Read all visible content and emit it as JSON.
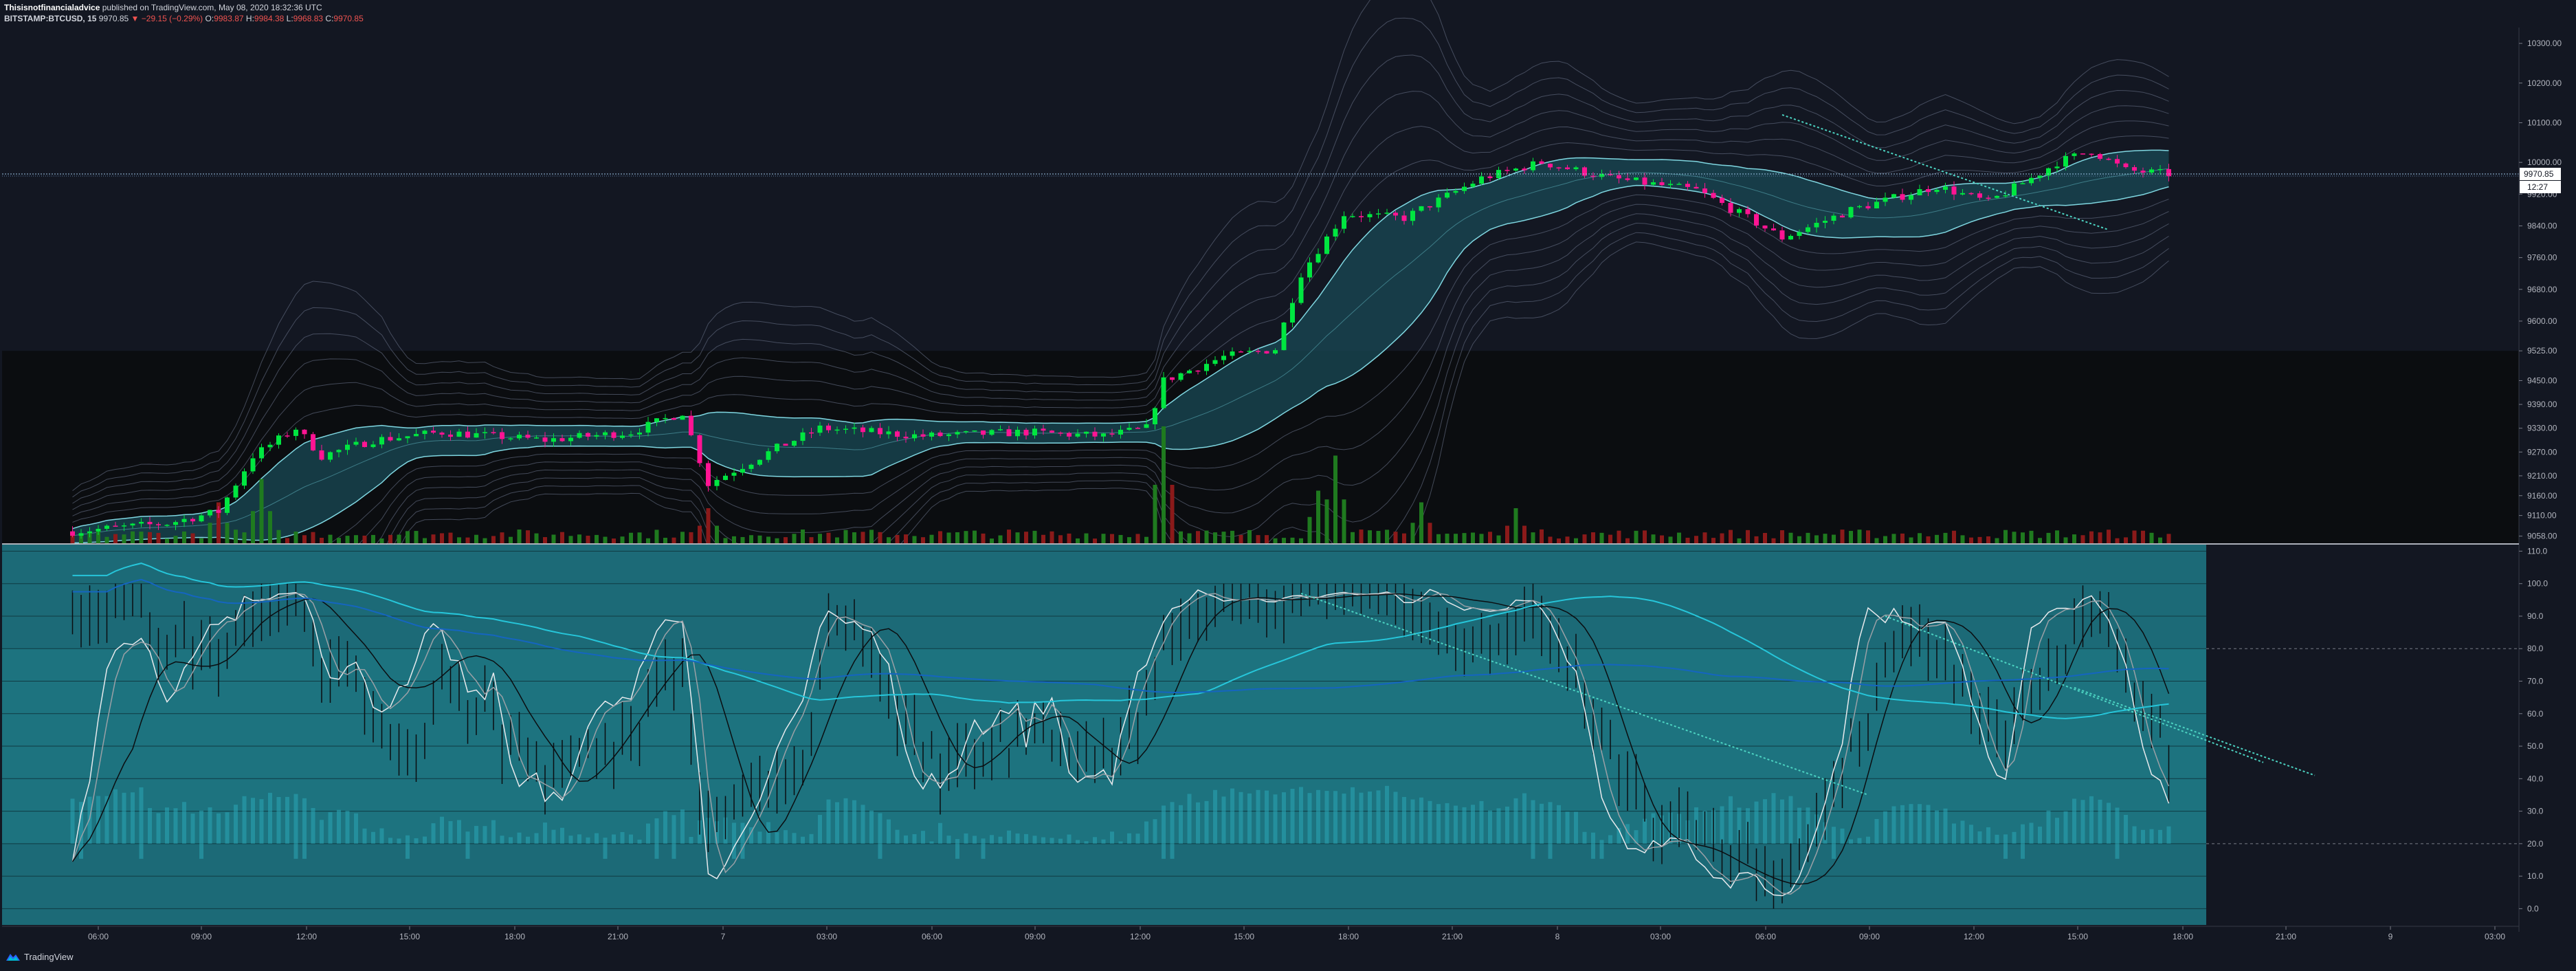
{
  "header": {
    "author": "Thisisnotfinancialadvice",
    "published": "published on TradingView.com, May 08, 2020 18:32:36 UTC",
    "symbol": "BITSTAMP:BTCUSD, 15",
    "last_price": "9970.85",
    "change_arrow": "▼",
    "change": "−29.15 (−0.29%)",
    "o_label": "O:",
    "o": "9983.87",
    "h_label": "H:",
    "h": "9984.38",
    "l_label": "L:",
    "l": "9968.83",
    "c_label": "C:",
    "c": "9970.85"
  },
  "footer": {
    "brand": "TradingView",
    "logo_icon": "tradingview-logo-icon"
  },
  "price_labels": {
    "last": "9970.85",
    "countdown": "12:27"
  },
  "colors": {
    "background": "#131722",
    "up_candle": "#00e640",
    "down_candle": "#ff1493",
    "volume_up": "#1f7a1f",
    "volume_down": "#8b1a1a",
    "band_fill": "#1a4a55",
    "band_line": "#7fd6e0",
    "oscillator_bg": "#1c6a77",
    "ma_cyan": "#26c6da",
    "ma_blue": "#1565c0",
    "trendline": "#4cd3c2"
  },
  "chart_data": [
    {
      "type": "candlestick",
      "title": "BITSTAMP:BTCUSD, 15",
      "ylim": [
        9040,
        10340
      ],
      "y_ticks": [
        "10300.00",
        "10200.00",
        "10100.00",
        "10000.00",
        "9920.00",
        "9840.00",
        "9760.00",
        "9680.00",
        "9600.00",
        "9525.00",
        "9450.00",
        "9390.00",
        "9330.00",
        "9270.00",
        "9210.00",
        "9160.00",
        "9110.00",
        "9058.00"
      ],
      "x_ticks": [
        "06:00",
        "09:00",
        "12:00",
        "15:00",
        "18:00",
        "21:00",
        "7",
        "03:00",
        "06:00",
        "09:00",
        "12:00",
        "15:00",
        "18:00",
        "21:00",
        "8",
        "03:00",
        "06:00",
        "09:00",
        "12:00",
        "15:00",
        "18:00",
        "21:00",
        "9",
        "03:00"
      ],
      "price_keypoints": [
        {
          "x": "05:15",
          "price": 9070
        },
        {
          "x": "08:00",
          "price": 9090
        },
        {
          "x": "09:30",
          "price": 9120
        },
        {
          "x": "10:30",
          "price": 9260
        },
        {
          "x": "11:45",
          "price": 9330
        },
        {
          "x": "12:30",
          "price": 9260
        },
        {
          "x": "14:00",
          "price": 9300
        },
        {
          "x": "16:00",
          "price": 9320
        },
        {
          "x": "19:00",
          "price": 9300
        },
        {
          "x": "21:30",
          "price": 9320
        },
        {
          "x": "23:00",
          "price": 9370
        },
        {
          "x": "23:45",
          "price": 9190
        },
        {
          "x": "7 01:45",
          "price": 9280
        },
        {
          "x": "7 03:00",
          "price": 9330
        },
        {
          "x": "7 06:00",
          "price": 9310
        },
        {
          "x": "7 09:00",
          "price": 9320
        },
        {
          "x": "7 11:15",
          "price": 9310
        },
        {
          "x": "7 12:30",
          "price": 9330
        },
        {
          "x": "7 13:00",
          "price": 9450
        },
        {
          "x": "7 14:45",
          "price": 9510
        },
        {
          "x": "7 16:15",
          "price": 9530
        },
        {
          "x": "7 17:00",
          "price": 9720
        },
        {
          "x": "7 18:15",
          "price": 9870
        },
        {
          "x": "7 20:00",
          "price": 9860
        },
        {
          "x": "7 22:15",
          "price": 9960
        },
        {
          "x": "8 00:00",
          "price": 10000
        },
        {
          "x": "8 02:00",
          "price": 9960
        },
        {
          "x": "8 04:30",
          "price": 9930
        },
        {
          "x": "8 06:00",
          "price": 9860
        },
        {
          "x": "8 07:00",
          "price": 9810
        },
        {
          "x": "8 09:00",
          "price": 9880
        },
        {
          "x": "8 11:30",
          "price": 9940
        },
        {
          "x": "8 13:00",
          "price": 9900
        },
        {
          "x": "8 14:15",
          "price": 9960
        },
        {
          "x": "8 15:00",
          "price": 10000
        },
        {
          "x": "8 16:00",
          "price": 10030
        },
        {
          "x": "8 17:00",
          "price": 9980
        },
        {
          "x": "8 18:15",
          "price": 9970.85
        }
      ],
      "volume_highlights": [
        {
          "x": "09:30",
          "level": 0.35
        },
        {
          "x": "10:45",
          "level": 0.55
        },
        {
          "x": "23:45",
          "level": 0.3
        },
        {
          "x": "7 13:00",
          "level": 1.0
        },
        {
          "x": "7 17:30",
          "level": 0.45
        },
        {
          "x": "7 18:00",
          "level": 0.75
        },
        {
          "x": "7 20:30",
          "level": 0.35
        },
        {
          "x": "7 23:15",
          "level": 0.3
        }
      ]
    },
    {
      "type": "line",
      "title": "",
      "ylim": [
        -5,
        112
      ],
      "y_ticks": [
        "110.0",
        "100.0",
        "90.0",
        "80.0",
        "70.0",
        "60.0",
        "50.0",
        "40.0",
        "30.0",
        "20.0",
        "10.0",
        "0.0"
      ],
      "levels": [
        80,
        20
      ],
      "series": [],
      "x_ticks": [
        "06:00",
        "09:00",
        "12:00",
        "15:00",
        "18:00",
        "21:00",
        "7",
        "03:00",
        "06:00",
        "09:00",
        "12:00",
        "15:00",
        "18:00",
        "21:00",
        "8",
        "03:00",
        "06:00",
        "09:00",
        "12:00",
        "15:00",
        "18:00",
        "21:00",
        "9",
        "03:00"
      ]
    }
  ]
}
